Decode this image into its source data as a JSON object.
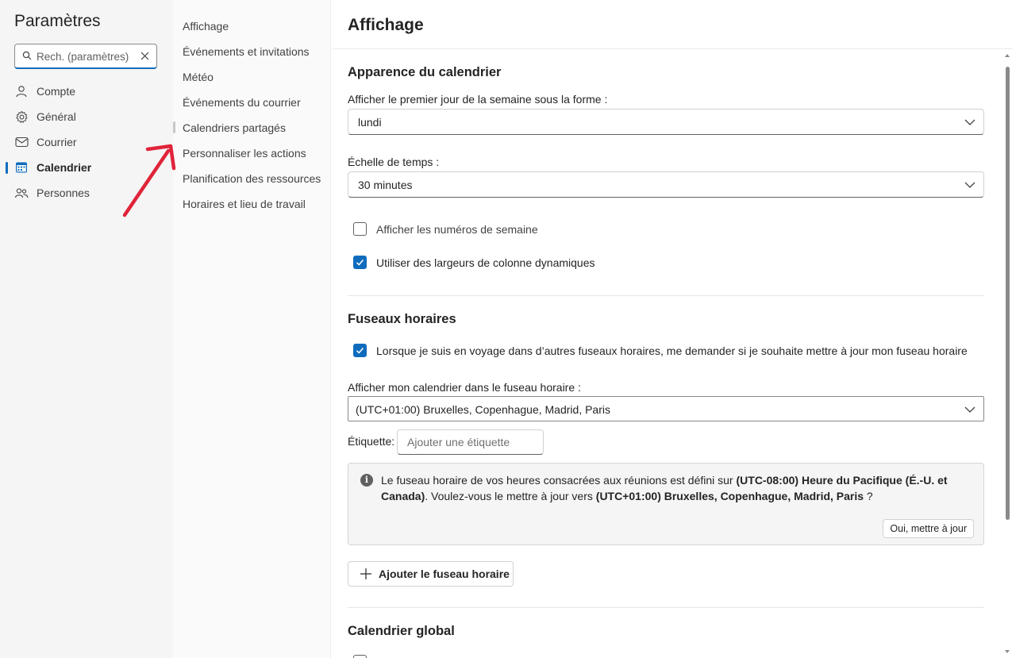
{
  "settings": {
    "title": "Paramètres"
  },
  "search": {
    "placeholder": "Rech. (paramètres)"
  },
  "nav": {
    "items": [
      {
        "label": "Compte",
        "icon": "person-icon"
      },
      {
        "label": "Général",
        "icon": "gear-icon"
      },
      {
        "label": "Courrier",
        "icon": "mail-icon"
      },
      {
        "label": "Calendrier",
        "icon": "calendar-icon",
        "active": true
      },
      {
        "label": "Personnes",
        "icon": "people-icon"
      }
    ]
  },
  "subnav": {
    "items": [
      {
        "label": "Affichage"
      },
      {
        "label": "Événements et invitations"
      },
      {
        "label": "Météo"
      },
      {
        "label": "Événements du courrier"
      },
      {
        "label": "Calendriers partagés"
      },
      {
        "label": "Personnaliser les actions"
      },
      {
        "label": "Planification des ressources"
      },
      {
        "label": "Horaires et lieu de travail"
      }
    ]
  },
  "page": {
    "title": "Affichage"
  },
  "appearance": {
    "title": "Apparence du calendrier",
    "first_day_label": "Afficher le premier jour de la semaine sous la forme :",
    "first_day_value": "lundi",
    "time_scale_label": "Échelle de temps :",
    "time_scale_value": "30 minutes",
    "week_numbers_label": "Afficher les numéros de semaine",
    "week_numbers_checked": false,
    "dynamic_columns_label": "Utiliser des largeurs de colonne dynamiques",
    "dynamic_columns_checked": true
  },
  "timezones": {
    "title": "Fuseaux horaires",
    "travel_prompt_label": "Lorsque je suis en voyage dans d’autres fuseaux horaires, me demander si je souhaite mettre à jour mon fuseau horaire",
    "travel_prompt_checked": true,
    "display_tz_label": "Afficher mon calendrier dans le fuseau horaire :",
    "display_tz_value": "(UTC+01:00) Bruxelles, Copenhague, Madrid, Paris",
    "tag_label": "Étiquette:",
    "tag_placeholder": "Ajouter une étiquette",
    "info": {
      "text_1": "Le fuseau horaire de vos heures consacrées aux réunions est défini sur ",
      "from_tz": "(UTC-08:00) Heure du Pacifique (É.-U. et Canada)",
      "text_2": ". Voulez-vous le mettre à jour vers ",
      "to_tz": "(UTC+01:00) Bruxelles, Copenhague, Madrid, Paris",
      "text_3": " ?",
      "button": "Oui, mettre à jour"
    },
    "add_button": "Ajouter le fuseau horaire"
  },
  "global_calendar": {
    "title": "Calendrier global"
  },
  "colors": {
    "accent": "#0f6cbd",
    "annotation": "#e0243a",
    "nav_bg": "#f5f5f5"
  }
}
